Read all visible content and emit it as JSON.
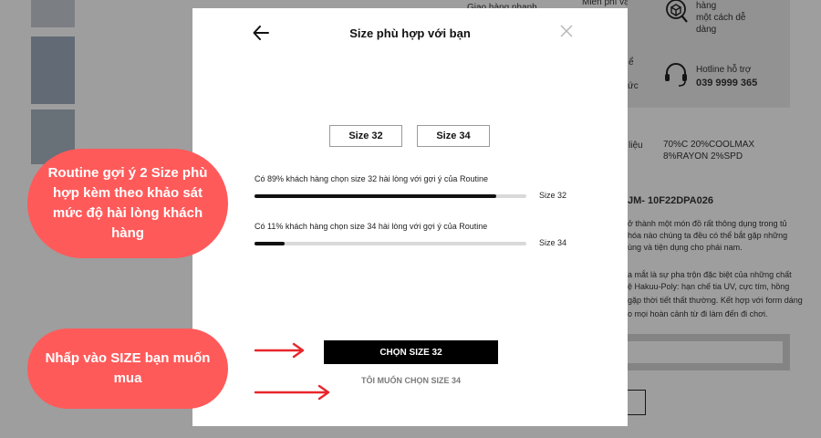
{
  "background": {
    "partial_texts": {
      "shipping_fast": "Giao hàng nhanh",
      "shipping_free": "Miễn phí vận",
      "exchange": [
        "hàng",
        "một cách dễ",
        "dàng"
      ],
      "hotline_label": "Hotline hỗ trợ",
      "hotline_number": "039 9999 365",
      "frag_e": "ể",
      "frag_uc": "ức",
      "material_label": "liệu",
      "material_value_1": "70%C 20%COOLMAX",
      "material_value_2": "8%RAYON 2%SPD",
      "sku": "JM- 10F22DPA026",
      "desc_1": "ở thành một món đồ rất thông dụng trong tủ",
      "desc_2": "hóa nào chúng ta đều có thể bắt gặp những",
      "desc_3": "ùng và tiện dụng cho phái nam.",
      "desc_4": "a mắt là sự pha trộn đặc biệt của những chất",
      "desc_5": "ệ Hakuu-Poly: hạn chế tia UV, cực tím, hồng",
      "desc_6": "gặp thời tiết thất thường. Kết hợp với form dáng",
      "desc_7": "o mọi hoàn cảnh từ đi làm đến đi chơi."
    }
  },
  "modal": {
    "title": "Size phù hợp với bạn",
    "back_icon": "arrow-left-icon",
    "close_icon": "close-icon",
    "size_options": [
      "Size 32",
      "Size 34"
    ],
    "survey": [
      {
        "text": "Có 89% khách hàng chọn size 32 hài lòng với gợi ý của Routine",
        "percent": 89,
        "label": "Size 32"
      },
      {
        "text": "Có 11% khách hàng chọn size 34 hài lòng với gợi ý của Routine",
        "percent": 11,
        "label": "Size 34"
      }
    ],
    "primary_button": "CHỌN SIZE 32",
    "secondary_link": "TÔI MUỐN CHỌN SIZE 34"
  },
  "annotations": {
    "callout_1": "Routine gợi ý 2 Size phù hợp kèm theo khảo sát mức độ hài lòng khách hàng",
    "callout_2": "Nhấp vào SIZE bạn muốn mua"
  },
  "colors": {
    "callout": "#ff5a5a",
    "arrow": "#e8262a",
    "primary": "#000000"
  }
}
